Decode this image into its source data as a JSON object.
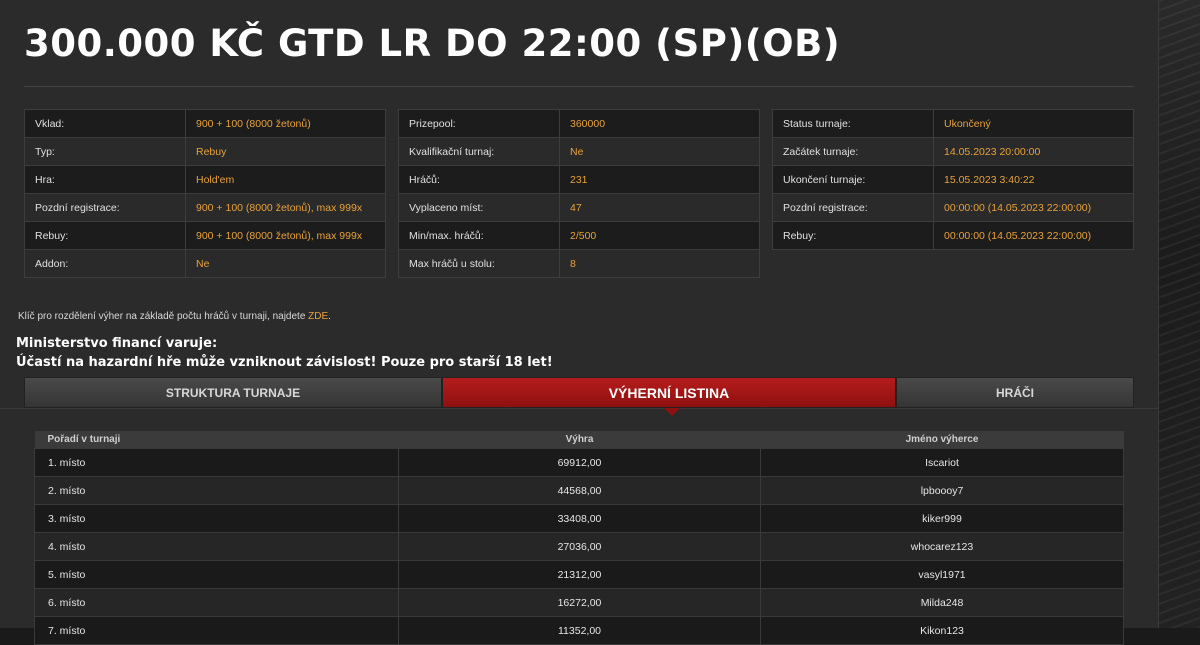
{
  "title": "300.000 KČ GTD LR DO 22:00 (SP)(OB)",
  "info_tables": [
    [
      {
        "label": "Vklad:",
        "value": "900 + 100 (8000 žetonů)"
      },
      {
        "label": "Typ:",
        "value": "Rebuy"
      },
      {
        "label": "Hra:",
        "value": "Hold'em"
      },
      {
        "label": "Pozdní registrace:",
        "value": "900 + 100 (8000 žetonů), max 999x"
      },
      {
        "label": "Rebuy:",
        "value": "900 + 100 (8000 žetonů), max 999x"
      },
      {
        "label": "Addon:",
        "value": "Ne"
      }
    ],
    [
      {
        "label": "Prizepool:",
        "value": "360000"
      },
      {
        "label": "Kvalifikační turnaj:",
        "value": "Ne"
      },
      {
        "label": "Hráčů:",
        "value": "231"
      },
      {
        "label": "Vyplaceno míst:",
        "value": "47"
      },
      {
        "label": "Min/max. hráčů:",
        "value": "2/500"
      },
      {
        "label": "Max hráčů u stolu:",
        "value": "8"
      }
    ],
    [
      {
        "label": "Status turnaje:",
        "value": "Ukončený"
      },
      {
        "label": "Začátek turnaje:",
        "value": "14.05.2023 20:00:00"
      },
      {
        "label": "Ukončení turnaje:",
        "value": "15.05.2023 3:40:22"
      },
      {
        "label": "Pozdní registrace:",
        "value": "00:00:00 (14.05.2023 22:00:00)"
      },
      {
        "label": "Rebuy:",
        "value": "00:00:00 (14.05.2023 22:00:00)"
      }
    ]
  ],
  "note": {
    "text": "Klíč pro rozdělení výher na základě počtu hráčů v turnaji, najdete",
    "link": "ZDE",
    "suffix": "."
  },
  "warning": {
    "line1": "Ministerstvo financí varuje:",
    "line2": "Účastí na hazardní hře může vzniknout závislost! Pouze pro starší 18 let!"
  },
  "tabs": [
    {
      "label": "STRUKTURA TURNAJE",
      "active": false
    },
    {
      "label": "VÝHERNÍ LISTINA",
      "active": true
    },
    {
      "label": "HRÁČI",
      "active": false
    }
  ],
  "winners": {
    "headers": [
      "Pořadí v turnaji",
      "Výhra",
      "Jméno výherce"
    ],
    "rows": [
      [
        "1. místo",
        "69912,00",
        "Iscariot"
      ],
      [
        "2. místo",
        "44568,00",
        "lpboooy7"
      ],
      [
        "3. místo",
        "33408,00",
        "kiker999"
      ],
      [
        "4. místo",
        "27036,00",
        "whocarez123"
      ],
      [
        "5. místo",
        "21312,00",
        "vasyl1971"
      ],
      [
        "6. místo",
        "16272,00",
        "Milda248"
      ],
      [
        "7. místo",
        "11352,00",
        "Kikon123"
      ]
    ]
  },
  "colors": {
    "accent_orange": "#e8a23a",
    "tab_active_red": "#b51c1c",
    "panel_bg": "#2b2b2b"
  }
}
